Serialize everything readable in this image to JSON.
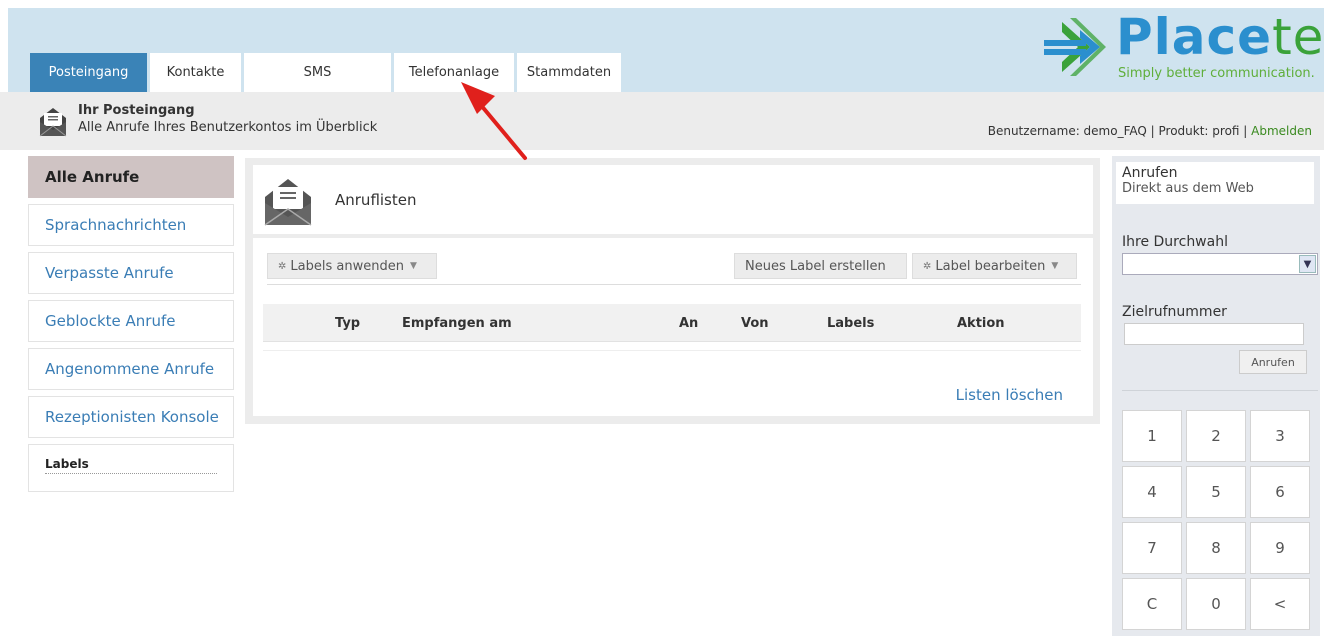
{
  "header": {
    "tabs": [
      {
        "label": "Posteingang"
      },
      {
        "label": "Kontakte"
      },
      {
        "label": "SMS"
      },
      {
        "label": "Telefonanlage"
      },
      {
        "label": "Stammdaten"
      }
    ],
    "logo": {
      "name": "Place",
      "name_suffix": "tel",
      "tagline": "Simply better communication."
    }
  },
  "subheader": {
    "title": "Ihr Posteingang",
    "description": "Alle Anrufe Ihres Benutzerkontos im Überblick",
    "userinfo": "Benutzername: demo_FAQ | Produkt: profi |",
    "logout": "Abmelden"
  },
  "sidebar": {
    "items": [
      {
        "label": "Alle Anrufe"
      },
      {
        "label": "Sprachnachrichten"
      },
      {
        "label": "Verpasste Anrufe"
      },
      {
        "label": "Geblockte Anrufe"
      },
      {
        "label": "Angenommene Anrufe"
      },
      {
        "label": "Rezeptionisten Konsole"
      }
    ],
    "labels_title": "Labels"
  },
  "main": {
    "title": "Anruflisten",
    "apply_labels": "Labels anwenden",
    "new_label": "Neues Label erstellen",
    "edit_label": "Label bearbeiten",
    "columns": [
      "Typ",
      "Empfangen am",
      "An",
      "Von",
      "Labels",
      "Aktion"
    ],
    "clear_lists": "Listen löschen"
  },
  "call_panel": {
    "title": "Anrufen",
    "subtitle": "Direkt aus dem Web",
    "extension_label": "Ihre Durchwahl",
    "target_label": "Zielrufnummer",
    "call_button": "Anrufen",
    "keys": [
      "1",
      "2",
      "3",
      "4",
      "5",
      "6",
      "7",
      "8",
      "9",
      "C",
      "0",
      "<"
    ]
  },
  "colors": {
    "header_band": "#cfe3ef",
    "active_tab": "#3a83b7",
    "link": "#3a7db5",
    "logout_link": "#3a8a20",
    "annotation_arrow": "#e0201c"
  }
}
